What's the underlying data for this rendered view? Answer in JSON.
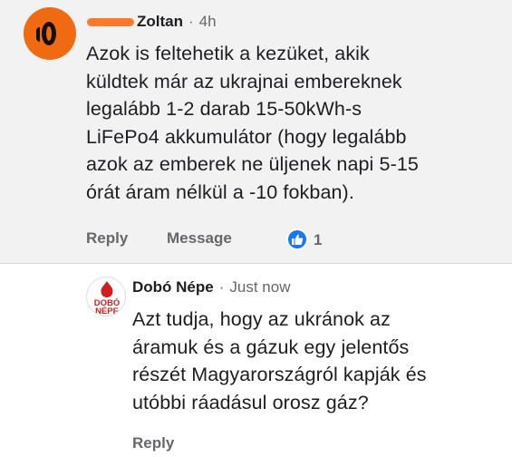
{
  "comment": {
    "author": "Zoltan",
    "time": "4h",
    "separator": "·",
    "lines": [
      "Azok is feltehetik a kezüket, akik",
      "küldtek már az ukrajnai embereknek",
      "legalább 1-2 darab 15-50kWh-s",
      "LiFePo4 akkumulátor (hogy legalább",
      "azok az emberek ne üljenek napi 5-15",
      "órát áram nélkül a -10 fokban)."
    ],
    "reply_label": "Reply",
    "message_label": "Message",
    "like_count": "1",
    "like_icon": "thumbs-up-icon",
    "accent": "#1877f2"
  },
  "reply": {
    "author": "Dobó Népe",
    "time": "Just now",
    "separator": "·",
    "avatar_text": "DOBÓ NÉPE",
    "lines": [
      "Azt tudja, hogy az ukránok az",
      "áramuk és a gázuk egy jelentős",
      "részét Magyarországról kapják és",
      "utóbbi ráadásul orosz gáz?"
    ],
    "reply_label": "Reply"
  }
}
